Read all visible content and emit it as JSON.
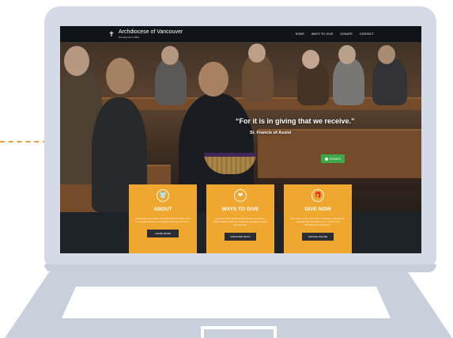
{
  "site": {
    "logo_icon": "cross-icon",
    "logo_title": "Archdiocese of Vancouver",
    "logo_subtitle": "Development Office",
    "nav": [
      "HOME",
      "WAYS TO GIVE",
      "DONATE",
      "CONTACT"
    ]
  },
  "hero": {
    "quote": "“For it is in giving that we receive.”",
    "author": "St. Francis of Assisi",
    "donate_label": "DONATE"
  },
  "cards": [
    {
      "icon": "shirt-icon",
      "title": "ABOUT",
      "body": "Learn about the mission of the Development Office, how we discern and fund our Appeals, and meet our team.",
      "button": "LEARN MORE"
    },
    {
      "icon": "hand-heart-icon",
      "title": "WAYS TO GIVE",
      "body": "Learn about the various giving options, including in-parish, Appeal, online and which we are able to receive that can help.",
      "button": "DISCOVER WAYS"
    },
    {
      "icon": "gift-icon",
      "title": "GIVE NOW",
      "body": "Give online to one of the many ministries, organizations, parishes that God calls to us, to serve in the Archdiocese of Vancouver.",
      "button": "DONATE ONLINE"
    }
  ],
  "colors": {
    "accent": "#f0a72f",
    "donate_green": "#3ea84a",
    "laptop_frame": "#d4dbe6",
    "dashed_line": "#e8a23a"
  }
}
